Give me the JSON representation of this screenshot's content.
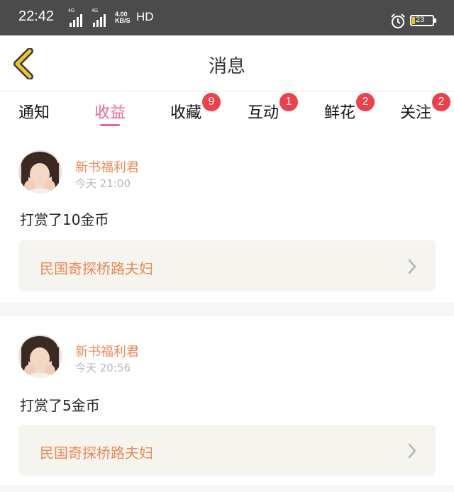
{
  "status_bar": {
    "time": "22:42",
    "signal_1_label": "4G",
    "signal_2_label": "4G",
    "speed_value": "4.00",
    "speed_unit": "KB/S",
    "network": "HD",
    "battery_level": "23"
  },
  "header": {
    "title": "消息"
  },
  "tabs": [
    {
      "label": "通知",
      "badge": ""
    },
    {
      "label": "收益",
      "badge": ""
    },
    {
      "label": "收藏",
      "badge": "9"
    },
    {
      "label": "互动",
      "badge": "1"
    },
    {
      "label": "鲜花",
      "badge": "2"
    },
    {
      "label": "关注",
      "badge": "2"
    }
  ],
  "active_tab": "收益",
  "messages": [
    {
      "sender": "新书福利君",
      "time": "今天 21:00",
      "text": "打赏了10金币",
      "book": "民国奇探桥路夫妇"
    },
    {
      "sender": "新书福利君",
      "time": "今天 20:56",
      "text": "打赏了5金币",
      "book": "民国奇探桥路夫妇"
    }
  ],
  "colors": {
    "accent": "#e8659c",
    "badge": "#ef3f4a",
    "sender": "#eb8a55",
    "back_arrow": "#f2c12e"
  }
}
